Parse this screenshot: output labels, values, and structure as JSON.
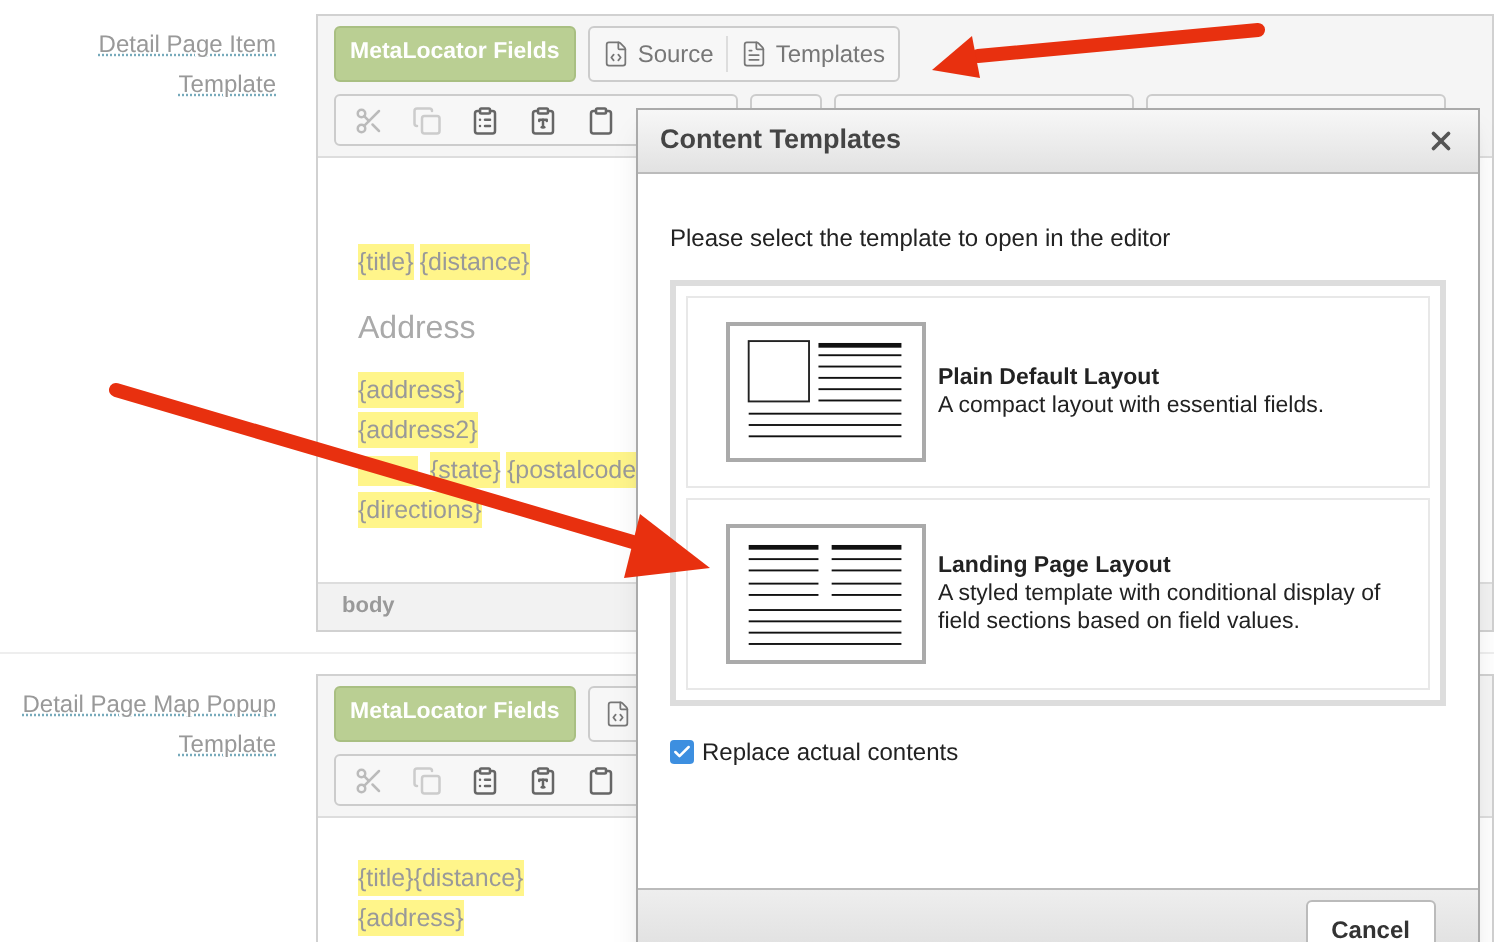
{
  "sections": [
    {
      "label": "Detail Page Item Template",
      "fields_button": "MetaLocator Fields",
      "source_button": "Source",
      "templates_button": "Templates",
      "content": [
        {
          "kind": "line",
          "tokens": [
            "{title}",
            "{distance}"
          ]
        },
        {
          "kind": "heading",
          "text": "Address"
        },
        {
          "kind": "line",
          "tokens": [
            "{address}"
          ]
        },
        {
          "kind": "line",
          "tokens": [
            "{address2}"
          ]
        },
        {
          "kind": "line",
          "covered_token": true,
          "tokens": [
            "{state}",
            "{postalcode"
          ]
        },
        {
          "kind": "line",
          "tokens": [
            "{directions}"
          ]
        }
      ],
      "footer": "body"
    },
    {
      "label": "Detail Page Map Popup Template",
      "fields_button": "MetaLocator Fields",
      "content": [
        {
          "kind": "line",
          "tokens": [
            "{title}{distance}"
          ]
        },
        {
          "kind": "line",
          "tokens": [
            "{address}"
          ]
        }
      ]
    }
  ],
  "dialog": {
    "title": "Content Templates",
    "prompt": "Please select the template to open in the editor",
    "templates": [
      {
        "kind": "plain",
        "name": "Plain Default Layout",
        "description": "A compact layout with essential fields."
      },
      {
        "kind": "landing",
        "name": "Landing Page Layout",
        "description": "A styled template with conditional display of field sections based on field values."
      }
    ],
    "replace": {
      "label": "Replace actual contents",
      "checked": true
    },
    "cancel": "Cancel"
  }
}
